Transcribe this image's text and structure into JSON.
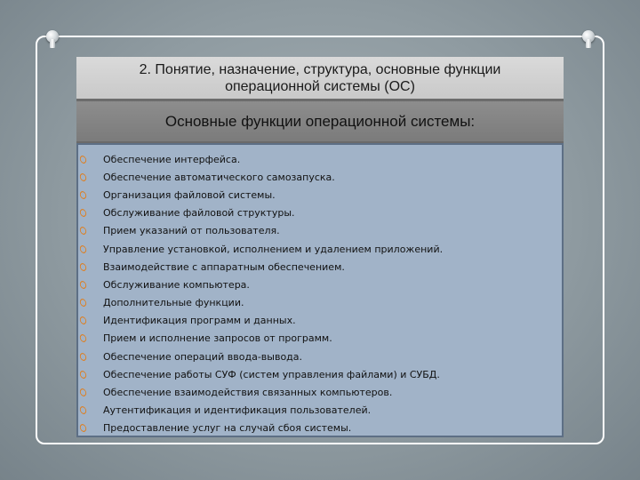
{
  "slide": {
    "title_line1": "2. Понятие, назначение, структура, основные функции",
    "title_line2": "операционной системы (ОС)",
    "subtitle": "Основные функции операционной системы:",
    "items": [
      "Обеспечение интерфейса.",
      "Обеспечение автоматического самозапуска.",
      "Организация файловой системы.",
      "Обслуживание файловой структуры.",
      "Прием указаний от пользователя.",
      "Управление установкой, исполнением и удалением приложений.",
      "Взаимодействие с аппаратным обеспечением.",
      "Обслуживание компьютера.",
      "Дополнительные функции.",
      "Идентификация программ и данных.",
      "Прием и исполнение запросов от программ.",
      "Обеспечение операций ввода-вывода.",
      "Обеспечение работы СУФ  (систем управления файлами) и СУБД.",
      "Обеспечение взаимодействия связанных компьютеров.",
      "Аутентификация и идентификация пользователей.",
      "Предоставление услуг на случай сбоя системы."
    ]
  },
  "icons": {
    "bullet": "orange-ring-bullet-icon",
    "pin": "push-pin-icon"
  },
  "colors": {
    "bullet": "#e47a10",
    "list_background": "#a1b3c8",
    "title_background": "#d2d2d2",
    "subtitle_background": "#858585"
  }
}
